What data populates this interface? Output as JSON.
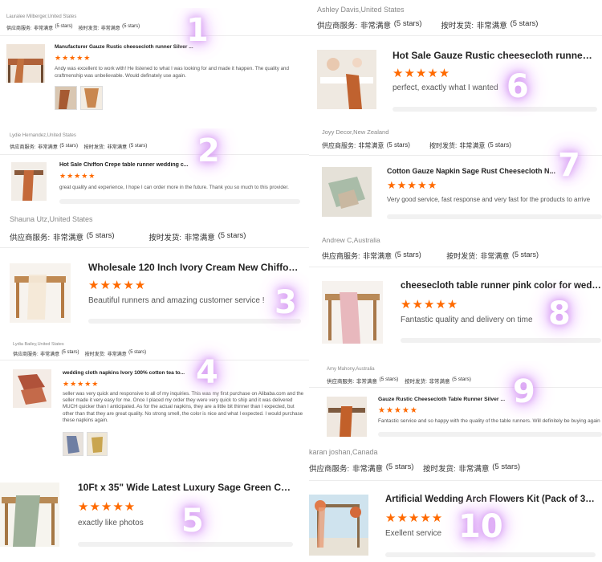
{
  "reviews": [
    {
      "reviewer": "Lauralee Milberger,United States",
      "supplier_label": "供应商服务:",
      "supplier_value": "非常满意",
      "supplier_stars": "(5 stars)",
      "shipping_label": "按时发货:",
      "shipping_value": "非常满意",
      "shipping_stars": "(5 stars)",
      "title": "Manufacturer Gauze Rustic cheesecloth runner Silver ...",
      "stars": "★★★★★",
      "comment": "Andy was excellent to work with! He listened to what I was looking for and made it happen. The quality and craftmenship was unbelievable. Would definately use again.",
      "number": "1"
    },
    {
      "reviewer": "Lydie Hernandez,United States",
      "supplier_label": "供应商服务:",
      "supplier_value": "非常满意",
      "supplier_stars": "(5 stars)",
      "shipping_label": "按时发货:",
      "shipping_value": "非常满意",
      "shipping_stars": "(5 stars)",
      "title": "Hot Sale Chiffon Crepe table runner wedding c...",
      "stars": "★★★★★",
      "comment": "great quality and experience, I hope I can order more in the future. Thank you so much to this provider.",
      "number": "2"
    },
    {
      "reviewer": "Shauna Utz,United States",
      "supplier_label": "供应商服务:",
      "supplier_value": "非常满意",
      "supplier_stars": "(5 stars)",
      "shipping_label": "按时发货:",
      "shipping_value": "非常满意",
      "shipping_stars": "(5 stars)",
      "title": "Wholesale 120 Inch Ivory Cream New Chiffon T...",
      "stars": "★★★★★",
      "comment": "Beautiful runners and amazing customer service !",
      "number": "3"
    },
    {
      "reviewer": "Lydia Bailey,United States",
      "supplier_label": "供应商服务:",
      "supplier_value": "非常满意",
      "supplier_stars": "(5 stars)",
      "shipping_label": "按时发货:",
      "shipping_value": "非常满意",
      "shipping_stars": "(5 stars)",
      "title": "wedding cloth napkins Ivory 100% cotton tea to...",
      "stars": "★★★★★",
      "comment": "seller was very quick and responsive to all of my inquiries. This was my first purchase on Alibaba.com and the seller made it very easy for me. Once I placed my order they were very quick to ship and it was delivered MUCH quicker than I anticipated. As for the actual napkins, they are a little bit thinner than I expected, but other than that they are great quality. No strong smell, the color is nice and what I expected. I would purchase these napkins again.",
      "number": "4"
    },
    {
      "title": "10Ft x 35\" Wide Latest Luxury Sage Green Che...",
      "stars": "★★★★★",
      "comment": "exactly like photos",
      "number": "5"
    },
    {
      "reviewer": "Ashley Davis,United States",
      "supplier_label": "供应商服务:",
      "supplier_value": "非常满意",
      "supplier_stars": "(5 stars)",
      "shipping_label": "按时发货:",
      "shipping_value": "非常满意",
      "shipping_stars": "(5 stars)",
      "title": "Hot Sale Gauze Rustic cheesecloth runner Silv...",
      "stars": "★★★★★",
      "comment": "perfect, exactly what I wanted",
      "number": "6"
    },
    {
      "reviewer": "Joyy Decor,New Zealand",
      "supplier_label": "供应商服务:",
      "supplier_value": "非常满意",
      "supplier_stars": "(5 stars)",
      "shipping_label": "按时发货:",
      "shipping_value": "非常满意",
      "shipping_stars": "(5 stars)",
      "title": "Cotton Gauze Napkin Sage Rust Cheesecloth N...",
      "stars": "★★★★★",
      "comment": "Very good service, fast response and very fast for the products to arrive",
      "number": "7"
    },
    {
      "reviewer": "Andrew C,Australia",
      "supplier_label": "供应商服务:",
      "supplier_value": "非常满意",
      "supplier_stars": "(5 stars)",
      "shipping_label": "按时发货:",
      "shipping_value": "非常满意",
      "shipping_stars": "(5 stars)",
      "title": "cheesecloth table runner pink color for wed an...",
      "stars": "★★★★★",
      "comment": "Fantastic quality and delivery on time",
      "number": "8"
    },
    {
      "reviewer": "Amy Mahony,Australia",
      "supplier_label": "供应商服务:",
      "supplier_value": "非常满意",
      "supplier_stars": "(5 stars)",
      "shipping_label": "按时发货:",
      "shipping_value": "非常满意",
      "shipping_stars": "(5 stars)",
      "title": "Gauze Rustic Cheesecloth Table Runner Silver ...",
      "stars": "★★★★★",
      "comment": "Fantastic service and so happy with the quality of the table runners. Will definitely be buying again",
      "number": "9"
    },
    {
      "reviewer": "karan joshan,Canada",
      "supplier_label": "供应商服务:",
      "supplier_value": "非常满意",
      "supplier_stars": "(5 stars)",
      "shipping_label": "按时发货:",
      "shipping_value": "非常满意",
      "shipping_stars": "(5 stars)",
      "title": "Artificial Wedding Arch Flowers Kit (Pack of 3),...",
      "stars": "★★★★★",
      "comment": "Exellent service",
      "number": "10"
    }
  ],
  "colors": {
    "star": "#ff6a00",
    "glow": "#d9a3f3"
  }
}
